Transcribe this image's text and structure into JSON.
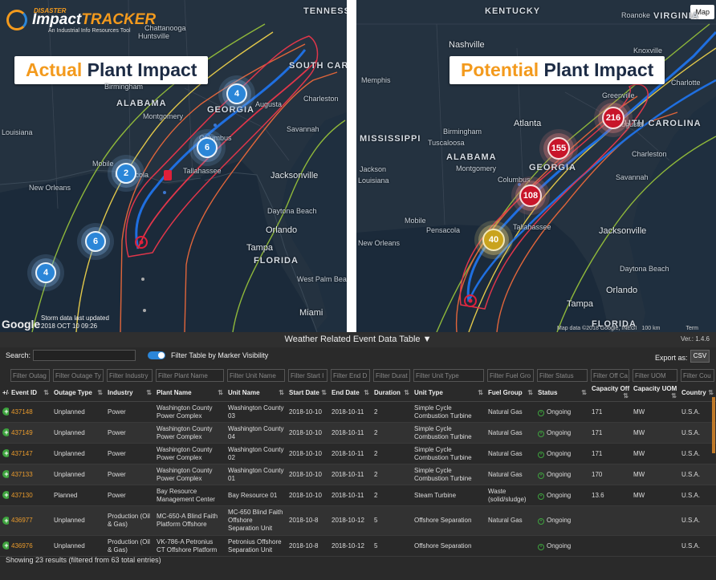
{
  "logo": {
    "top": "DISASTER",
    "name_a": "Impact",
    "name_b": "TRACKER",
    "tagline": "An Industrial Info Resources Tool"
  },
  "left_map": {
    "banner_highlight": "Actual",
    "banner_rest": " Plant Impact",
    "places": [
      {
        "t": "TENNESSEE"
      },
      {
        "t": "Chattanooga"
      },
      {
        "t": "Huntsville"
      },
      {
        "t": "Birmingham"
      },
      {
        "t": "ALABAMA"
      },
      {
        "t": "GEORGIA"
      },
      {
        "t": "SOUTH CAROLINA"
      },
      {
        "t": "Charleston"
      },
      {
        "t": "Savannah"
      },
      {
        "t": "Jacksonville"
      },
      {
        "t": "Tallahassee"
      },
      {
        "t": "Mobile"
      },
      {
        "t": "Pensacola"
      },
      {
        "t": "New Orleans"
      },
      {
        "t": "Daytona Beach"
      },
      {
        "t": "Orlando"
      },
      {
        "t": "Tampa"
      },
      {
        "t": "FLORIDA"
      },
      {
        "t": "West Palm Beach"
      },
      {
        "t": "Miami"
      },
      {
        "t": "Montgomery"
      },
      {
        "t": "Columbus"
      },
      {
        "t": "Augusta"
      },
      {
        "t": "Louisiana"
      }
    ],
    "markers": [
      "4",
      "6",
      "2",
      "6",
      "4"
    ],
    "google": "Google",
    "storm_note_1": "Storm data last updated",
    "storm_note_2": "2018 OCT 10 09:26"
  },
  "right_map": {
    "banner_highlight": "Potential",
    "banner_rest": " Plant Impact",
    "map_button": "Map",
    "places": [
      {
        "t": "KENTUCKY"
      },
      {
        "t": "Roanoke"
      },
      {
        "t": "VIRGINIA"
      },
      {
        "t": "Nashville"
      },
      {
        "t": "Knoxville"
      },
      {
        "t": "Memphis"
      },
      {
        "t": "MISSISSIPPI"
      },
      {
        "t": "Atlanta"
      },
      {
        "t": "Birmingham"
      },
      {
        "t": "ALABAMA"
      },
      {
        "t": "Tuscaloosa"
      },
      {
        "t": "GEORGIA"
      },
      {
        "t": "SOUTH CAROLINA"
      },
      {
        "t": "Charlotte"
      },
      {
        "t": "Charleston"
      },
      {
        "t": "Savannah"
      },
      {
        "t": "Jackson"
      },
      {
        "t": "Montgomery"
      },
      {
        "t": "Columbus"
      },
      {
        "t": "Pensacola"
      },
      {
        "t": "Tallahassee"
      },
      {
        "t": "Jacksonville"
      },
      {
        "t": "New Orleans"
      },
      {
        "t": "Daytona Beach"
      },
      {
        "t": "Orlando"
      },
      {
        "t": "Tampa"
      },
      {
        "t": "FLORIDA"
      },
      {
        "t": "Augusta"
      },
      {
        "t": "Greenville"
      },
      {
        "t": "Mobile"
      },
      {
        "t": "Louisiana"
      }
    ],
    "markers": [
      "216",
      "155",
      "108",
      "40"
    ],
    "attribution": "Map data ©2018 Google, INEGI",
    "scale": "100 km",
    "terms": "Term"
  },
  "table": {
    "title": "Weather Related Event Data Table",
    "version": "Ver.: 1.4.6",
    "search_label": "Search:",
    "toggle_label": "Filter Table by Marker Visibility",
    "export_label": "Export as:",
    "csv": "CSV",
    "filters": [
      "",
      "Filter Outag",
      "Filter Outage Ty",
      "Filter Industry",
      "Filter Plant Name",
      "Filter Unit Name",
      "Filter Start I",
      "Filter End D",
      "Filter Durat",
      "Filter Unit Type",
      "Filter Fuel Gro",
      "Filter Status",
      "Filter Off Ca",
      "Filter UOM",
      "Filter Cou"
    ],
    "headers": [
      "+/-",
      "Event ID",
      "Outage Type",
      "Industry",
      "Plant Name",
      "Unit Name",
      "Start Date",
      "End Date",
      "Duration",
      "Unit Type",
      "Fuel Group",
      "Status",
      "Capacity Off",
      "Capacity UOM",
      "Country"
    ],
    "rows": [
      [
        "437148",
        "Unplanned",
        "Power",
        "Washington County Power Complex",
        "Washington County 03",
        "2018-10-10",
        "2018-10-11",
        "2",
        "Simple Cycle Combustion Turbine",
        "Natural Gas",
        "Ongoing",
        "171",
        "MW",
        "U.S.A."
      ],
      [
        "437149",
        "Unplanned",
        "Power",
        "Washington County Power Complex",
        "Washington County 04",
        "2018-10-10",
        "2018-10-11",
        "2",
        "Simple Cycle Combustion Turbine",
        "Natural Gas",
        "Ongoing",
        "171",
        "MW",
        "U.S.A."
      ],
      [
        "437147",
        "Unplanned",
        "Power",
        "Washington County Power Complex",
        "Washington County 02",
        "2018-10-10",
        "2018-10-11",
        "2",
        "Simple Cycle Combustion Turbine",
        "Natural Gas",
        "Ongoing",
        "171",
        "MW",
        "U.S.A."
      ],
      [
        "437133",
        "Unplanned",
        "Power",
        "Washington County Power Complex",
        "Washington County 01",
        "2018-10-10",
        "2018-10-11",
        "2",
        "Simple Cycle Combustion Turbine",
        "Natural Gas",
        "Ongoing",
        "170",
        "MW",
        "U.S.A."
      ],
      [
        "437130",
        "Planned",
        "Power",
        "Bay Resource Management Center",
        "Bay Resource 01",
        "2018-10-10",
        "2018-10-11",
        "2",
        "Steam Turbine",
        "Waste (solid/sludge)",
        "Ongoing",
        "13.6",
        "MW",
        "U.S.A."
      ],
      [
        "436977",
        "Unplanned",
        "Production (Oil & Gas)",
        "MC-650-A Blind Faith Platform Offshore",
        "MC-650 Blind Faith Offshore Separation Unit",
        "2018-10-8",
        "2018-10-12",
        "5",
        "Offshore Separation",
        "Natural Gas",
        "Ongoing",
        "",
        "",
        "U.S.A."
      ],
      [
        "436976",
        "Unplanned",
        "Production (Oil & Gas)",
        "VK-786-A Petronius CT Offshore Platform",
        "Petronius Offshore Separation Unit",
        "2018-10-8",
        "2018-10-12",
        "5",
        "Offshore Separation",
        "",
        "Ongoing",
        "",
        "",
        "U.S.A."
      ]
    ],
    "footer": "Showing 23 results (filtered from 63 total entries)"
  }
}
